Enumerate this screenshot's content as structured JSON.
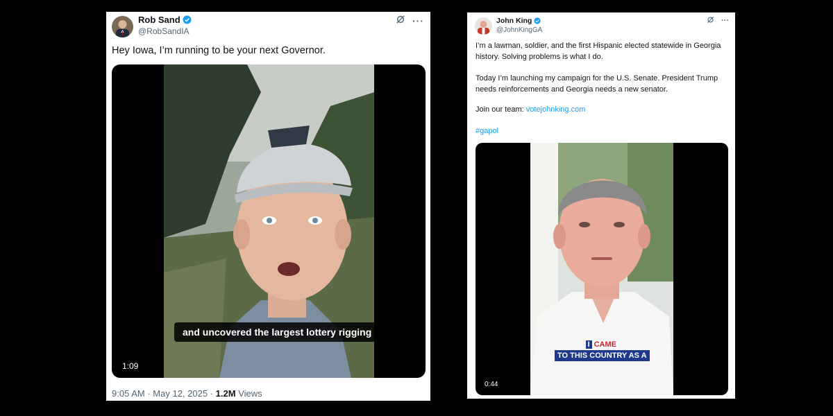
{
  "tweet1": {
    "name": "Rob Sand",
    "handle": "@RobSandIA",
    "text": "Hey Iowa, I’m running to be your next Governor.",
    "video": {
      "duration": "1:09",
      "caption": "and uncovered the largest lottery rigging"
    },
    "footer": {
      "time": "9:05 AM",
      "separator": "·",
      "date": "May 12, 2025",
      "views_count": "1.2M",
      "views_label": "Views"
    }
  },
  "tweet2": {
    "name": "John King",
    "handle": "@JohnKingGA",
    "paragraph1": "I’m a lawman, soldier, and the first Hispanic elected statewide in Georgia history. Solving problems is what I do.",
    "paragraph2": "Today I’m launching my campaign for the U.S. Senate. President Trump needs reinforcements and Georgia needs a new senator.",
    "join_label": "Join our team:",
    "join_link": "votejohnking.com",
    "hashtag": "#gapol",
    "video": {
      "duration": "0:44",
      "caption_line1_a": "I",
      "caption_line1_b": "CAME",
      "caption_line2": "TO THIS COUNTRY AS A"
    }
  },
  "colors": {
    "accent": "#1d9bf0",
    "text": "#0f1419",
    "muted": "#536471",
    "caption_red": "#d21f2b",
    "caption_navy": "#1f3a8c"
  },
  "icons": [
    "verified-badge-icon",
    "grok-icon",
    "more-options-icon"
  ]
}
